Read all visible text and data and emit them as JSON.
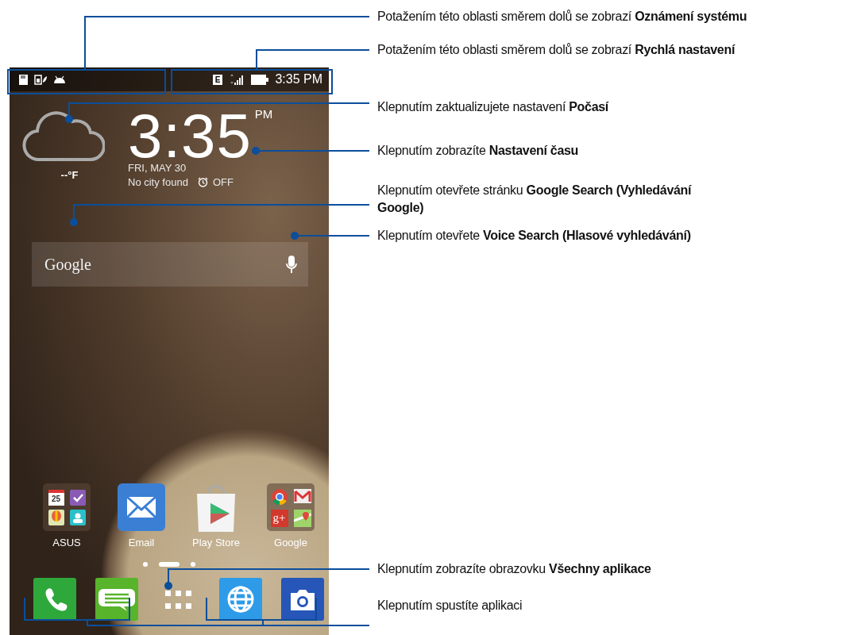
{
  "status_bar": {
    "network_type": "E",
    "time": "3:35 PM"
  },
  "clock_widget": {
    "temperature": "--°F",
    "time": "3:35",
    "ampm": "PM",
    "date": "FRI, MAY 30",
    "city": "No city found",
    "alarm": "OFF"
  },
  "search_bar": {
    "logo": "Google"
  },
  "home_apps": [
    {
      "label": "ASUS",
      "kind": "folder",
      "tiles": [
        {
          "kind": "calendar",
          "text": "25"
        },
        {
          "kind": "tasks"
        },
        {
          "kind": "balloon"
        },
        {
          "kind": "contacts"
        }
      ]
    },
    {
      "label": "Email",
      "kind": "email"
    },
    {
      "label": "Play Store",
      "kind": "store"
    },
    {
      "label": "Google",
      "kind": "folder",
      "tiles": [
        {
          "kind": "chrome"
        },
        {
          "kind": "gmail"
        },
        {
          "kind": "gplus",
          "text": "g+"
        },
        {
          "kind": "maps"
        }
      ]
    }
  ],
  "page_indicator": [
    {
      "selected": false
    },
    {
      "selected": true
    },
    {
      "selected": false
    }
  ],
  "dock": [
    {
      "kind": "phone"
    },
    {
      "kind": "messages"
    },
    {
      "kind": "apps"
    },
    {
      "kind": "browser"
    },
    {
      "kind": "camera"
    }
  ],
  "callouts": [
    "Potažením této oblasti směrem dolů se zobrazí **Oznámení systému**",
    "Potažením této oblasti směrem dolů se zobrazí **Rychlá nastavení**",
    "Klepnutím zaktualizujete nastavení **Počasí**",
    "Klepnutím zobrazíte **Nastavení času**",
    "Klepnutím otevřete stránku **Google Search (Vyhledávání Google)**",
    "Klepnutím otevřete **Voice Search (Hlasové vyhledávání)**",
    "Klepnutím zobrazíte obrazovku **Všechny aplikace**",
    "Klepnutím spustíte aplikaci"
  ]
}
